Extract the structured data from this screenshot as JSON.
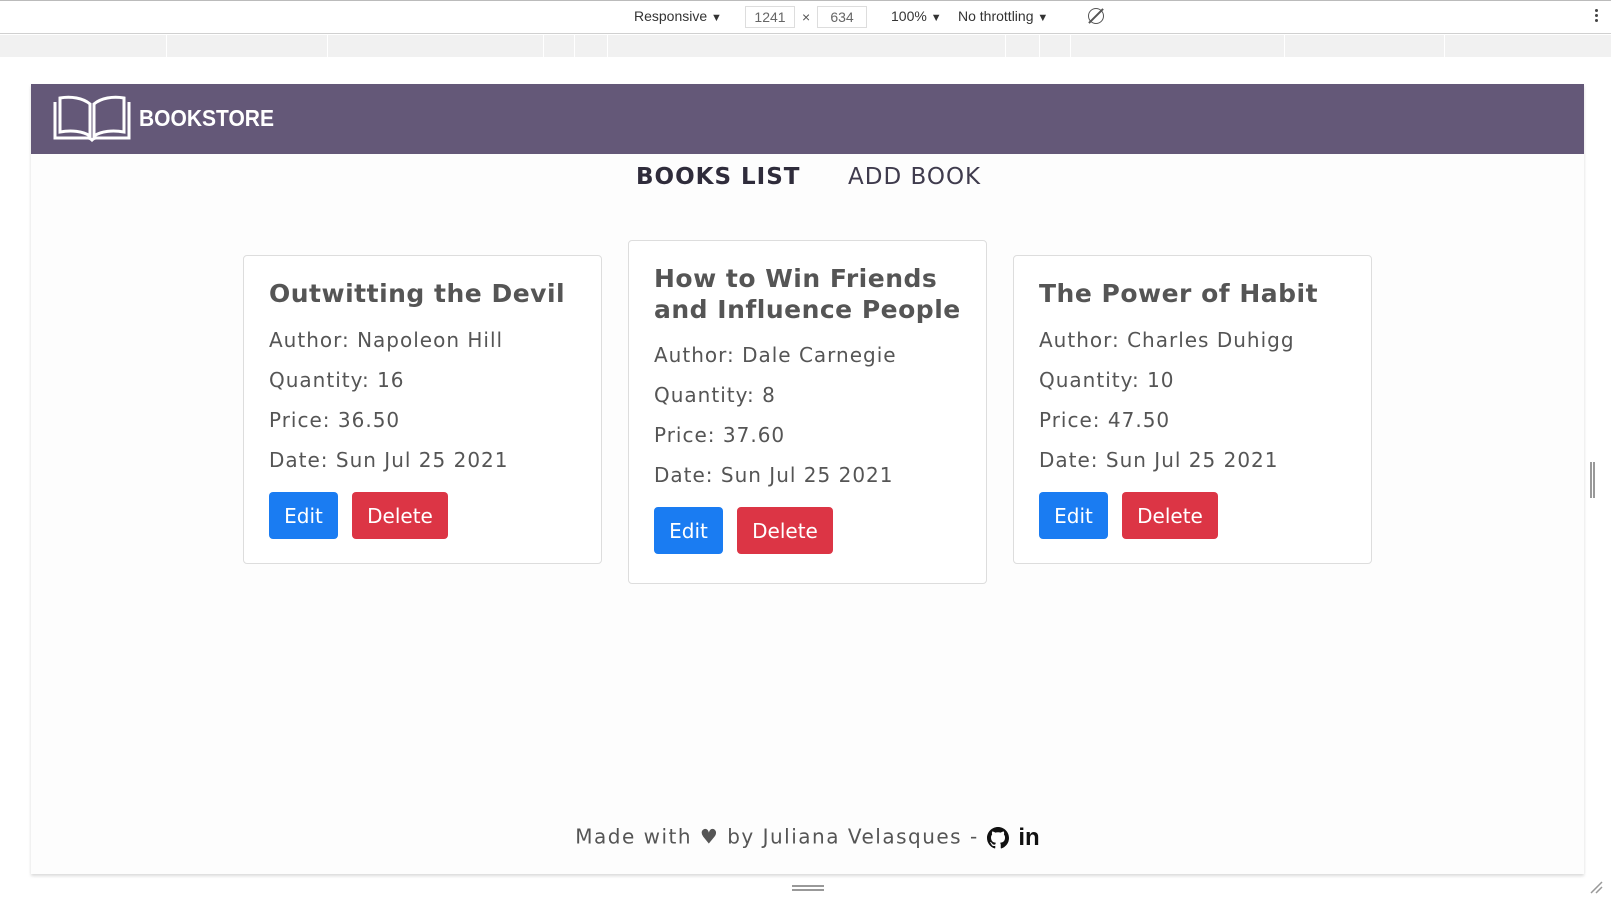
{
  "devtools": {
    "device": "Responsive",
    "width": "1241",
    "times": "×",
    "height": "634",
    "zoom": "100%",
    "throttling": "No throttling",
    "dropdown_arrow": "▼"
  },
  "header": {
    "brand": "BOOKSTORE",
    "logo_icon": "open-book-icon",
    "background": "#645878"
  },
  "nav": {
    "books_list": "BOOKS LIST",
    "add_book": "ADD BOOK"
  },
  "books": [
    {
      "title": "Outwitting the Devil",
      "author": "Author: Napoleon Hill",
      "quantity": "Quantity: 16",
      "price": "Price: 36.50",
      "date": "Date: Sun Jul 25 2021",
      "edit": "Edit",
      "delete": "Delete"
    },
    {
      "title": "How to Win Friends and Influence People",
      "author": "Author: Dale Carnegie",
      "quantity": "Quantity: 8",
      "price": "Price: 37.60",
      "date": "Date: Sun Jul 25 2021",
      "edit": "Edit",
      "delete": "Delete"
    },
    {
      "title": "The Power of Habit",
      "author": "Author: Charles Duhigg",
      "quantity": "Quantity: 10",
      "price": "Price: 47.50",
      "date": "Date: Sun Jul 25 2021",
      "edit": "Edit",
      "delete": "Delete"
    }
  ],
  "colors": {
    "edit": "#1a7cf2",
    "delete": "#dc3545"
  },
  "footer": {
    "text": "Made with ♥ by Juliana Velasques - ",
    "linkedin": "in",
    "github_icon": "github-icon"
  }
}
